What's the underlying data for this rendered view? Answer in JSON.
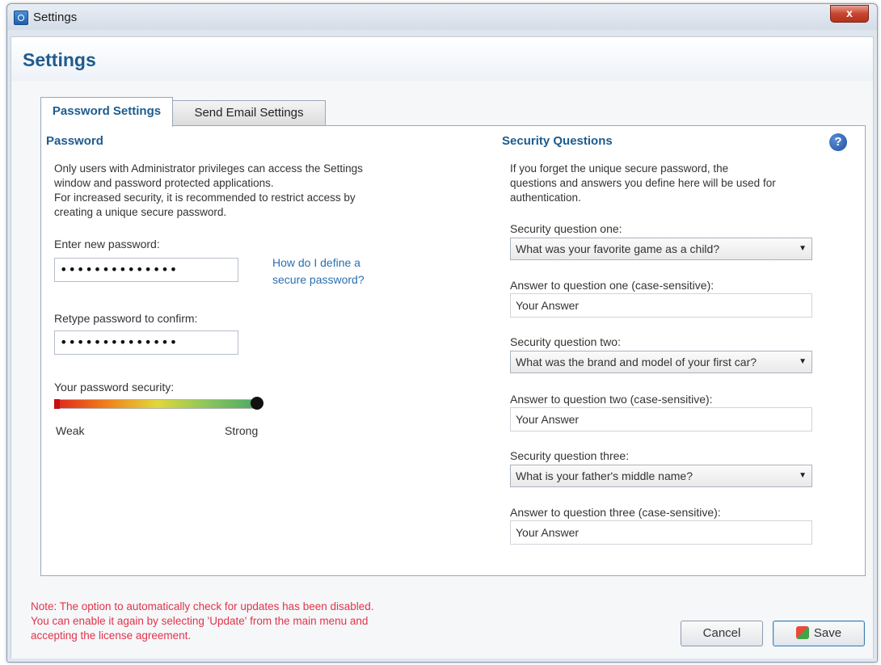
{
  "window": {
    "title": "Settings",
    "close_glyph": "x"
  },
  "header": {
    "title": "Settings"
  },
  "tabs": [
    {
      "label": "Password Settings",
      "active": true
    },
    {
      "label": "Send Email Settings",
      "active": false
    }
  ],
  "password": {
    "heading": "Password",
    "info_lines": [
      "Only users with Administrator privileges can access the Settings",
      "window and password protected applications.",
      "For increased security, it is recommended to restrict access by",
      "creating a unique secure password."
    ],
    "new_label": "Enter new password:",
    "new_value": "••••••••••••••",
    "help_link_line1": "How do I define a",
    "help_link_line2": "secure password?",
    "retype_label": "Retype password to confirm:",
    "retype_value": "••••••••••••••",
    "security_label": "Your password security:",
    "security_level": 1.0,
    "weak_label": "Weak",
    "strong_label": "Strong"
  },
  "security": {
    "heading": "Security Questions",
    "help_glyph": "?",
    "info_lines": [
      "If you forget the unique secure password, the",
      "questions and answers you define here will be used for",
      "authentication."
    ],
    "q1_label": "Security question one:",
    "q1_value": "What was your favorite game as a child?",
    "a1_label": "Answer to question one (case-sensitive):",
    "a1_value": "Your Answer",
    "q2_label": "Security question two:",
    "q2_value": "What was the brand and model of your first car?",
    "a2_label": "Answer to question two (case-sensitive):",
    "a2_value": "Your Answer",
    "q3_label": "Security question three:",
    "q3_value": "What is your father's middle name?",
    "a3_label": "Answer to question three (case-sensitive):",
    "a3_value": "Your Answer"
  },
  "note": {
    "lines": [
      "Note: The option to automatically check for updates has been disabled.",
      "You can enable it again by selecting 'Update' from the main menu and",
      "accepting the license agreement."
    ]
  },
  "buttons": {
    "cancel": "Cancel",
    "save": "Save"
  },
  "colors": {
    "heading_blue": "#1e5b8f",
    "link_blue": "#2a6fb1",
    "note_red": "#e0354a"
  },
  "icons": {
    "app": "settings-app-icon",
    "help": "help-icon",
    "save": "save-shield-icon",
    "dropdown": "chevron-down-icon"
  }
}
